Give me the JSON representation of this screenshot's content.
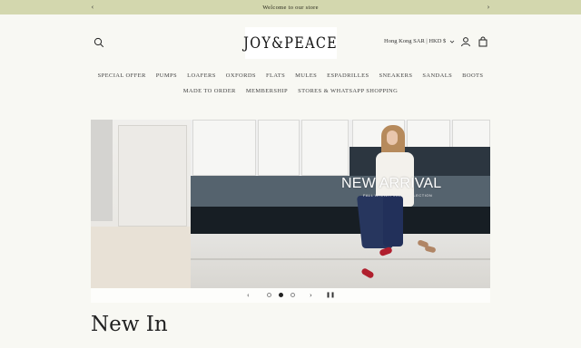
{
  "announcement": {
    "message": "Welcome to our store",
    "prev_icon": "chevron-left-icon",
    "next_icon": "chevron-right-icon"
  },
  "header": {
    "logo_text": "JOY&PEACE",
    "currency": "Hong Kong SAR | HKD $",
    "icons": [
      "search-icon",
      "account-icon",
      "cart-icon"
    ]
  },
  "nav": {
    "row1": [
      "SPECIAL OFFER",
      "PUMPS",
      "LOAFERS",
      "OXFORDS",
      "FLATS",
      "MULES",
      "ESPADRILLES",
      "SNEAKERS",
      "SANDALS",
      "BOOTS"
    ],
    "row2": [
      "MADE TO ORDER",
      "MEMBERSHIP",
      "STORES & WHATSAPP SHOPPING"
    ]
  },
  "hero": {
    "title": "NEW ARRIVAL",
    "subtitle": "FALL WINTER 2025 COLLECTION"
  },
  "slider": {
    "prev": "‹",
    "next": "›",
    "pause": "❚❚",
    "slides": 3,
    "active_index": 1
  },
  "section": {
    "title": "New In"
  },
  "colors": {
    "announcement_bg": "#d3d7ae",
    "page_bg": "#f8f8f3"
  }
}
